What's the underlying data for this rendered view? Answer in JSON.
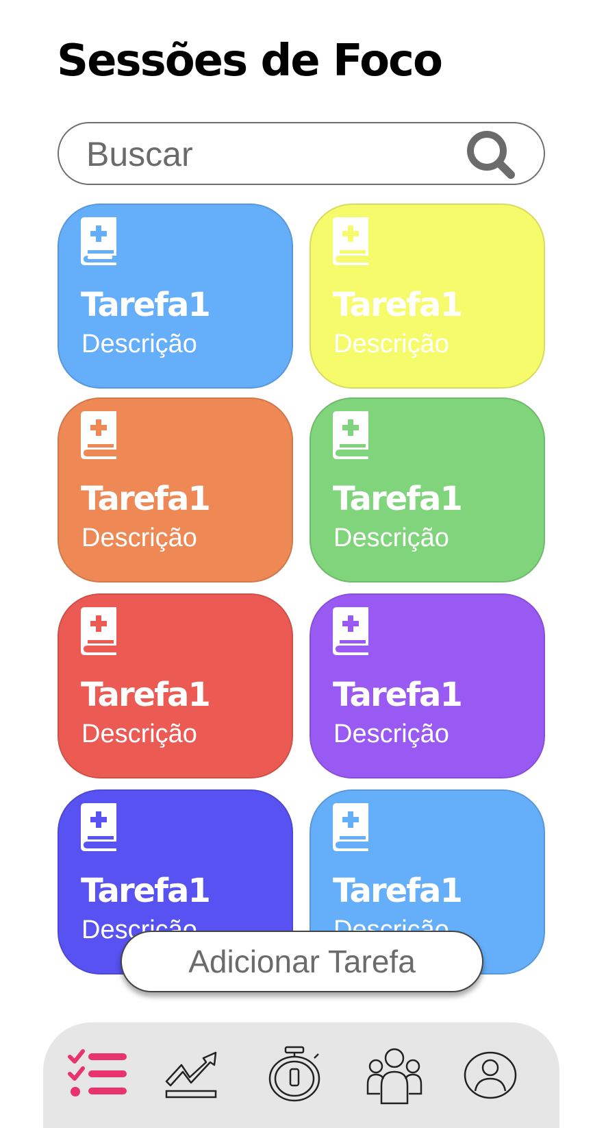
{
  "header": {
    "title": "Sessões de Foco"
  },
  "search": {
    "placeholder": "Buscar"
  },
  "tasks": [
    {
      "title": "Tarefa1",
      "description": "Descrição",
      "color": "#64aefa",
      "icon": "book-plus-icon"
    },
    {
      "title": "Tarefa1",
      "description": "Descrição",
      "color": "#f5fb6b",
      "icon": "book-plus-icon"
    },
    {
      "title": "Tarefa1",
      "description": "Descrição",
      "color": "#ee8956",
      "icon": "book-plus-icon"
    },
    {
      "title": "Tarefa1",
      "description": "Descrição",
      "color": "#7fd47c",
      "icon": "book-plus-icon"
    },
    {
      "title": "Tarefa1",
      "description": "Descrição",
      "color": "#ec5a54",
      "icon": "book-plus-icon"
    },
    {
      "title": "Tarefa1",
      "description": "Descrição",
      "color": "#995af4",
      "icon": "book-plus-icon"
    },
    {
      "title": "Tarefa1",
      "description": "Descrição",
      "color": "#5852f2",
      "icon": "book-plus-icon"
    },
    {
      "title": "Tarefa1",
      "description": "Descrição",
      "color": "#64aefa",
      "icon": "book-plus-icon"
    }
  ],
  "actions": {
    "add_task_label": "Adicionar Tarefa"
  },
  "nav": {
    "items": [
      {
        "icon": "task-list-icon",
        "active": true,
        "color": "#e8336c"
      },
      {
        "icon": "trend-chart-icon",
        "active": false
      },
      {
        "icon": "stopwatch-icon",
        "active": false
      },
      {
        "icon": "group-icon",
        "active": false
      },
      {
        "icon": "profile-icon",
        "active": false
      }
    ]
  }
}
